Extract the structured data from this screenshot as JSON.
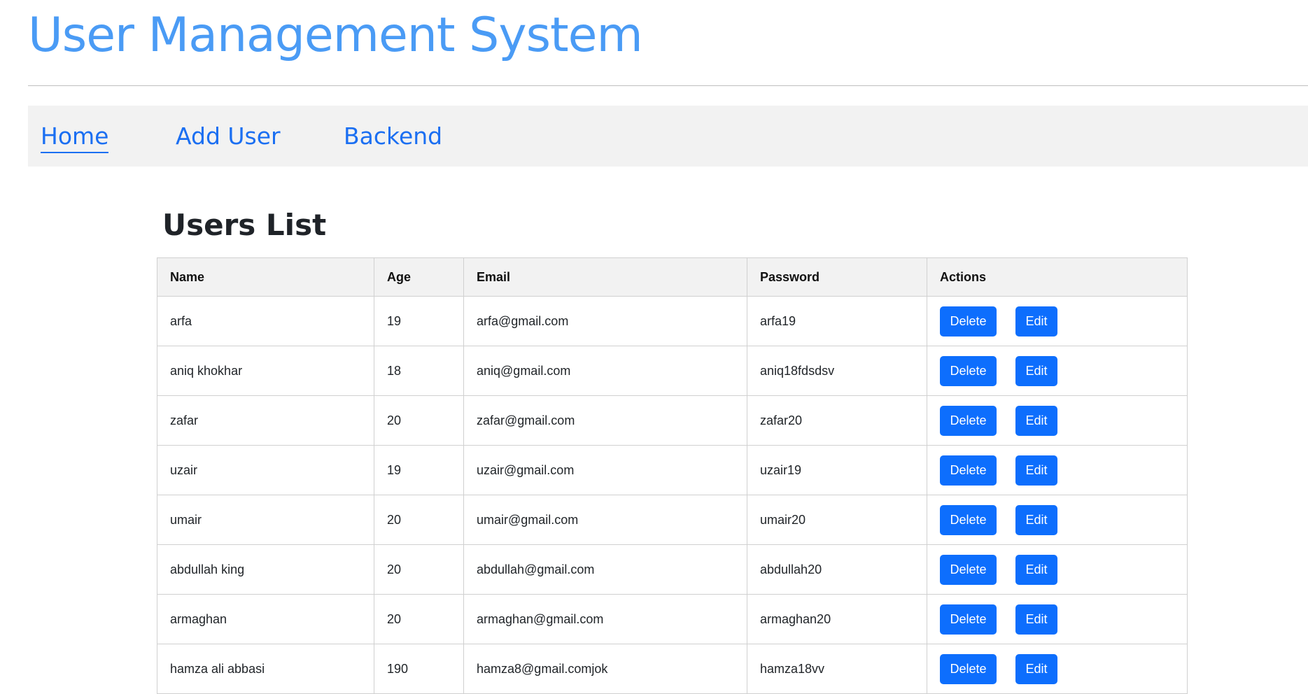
{
  "app": {
    "title": "User Management System"
  },
  "nav": {
    "items": [
      {
        "label": "Home",
        "active": true
      },
      {
        "label": "Add User",
        "active": false
      },
      {
        "label": "Backend",
        "active": false
      }
    ]
  },
  "main": {
    "heading": "Users List",
    "table": {
      "columns": [
        "Name",
        "Age",
        "Email",
        "Password",
        "Actions"
      ],
      "delete_label": "Delete",
      "edit_label": "Edit",
      "rows": [
        {
          "name": "arfa",
          "age": "19",
          "email": "arfa@gmail.com",
          "password": "arfa19"
        },
        {
          "name": "aniq khokhar",
          "age": "18",
          "email": "aniq@gmail.com",
          "password": "aniq18fdsdsv"
        },
        {
          "name": "zafar",
          "age": "20",
          "email": "zafar@gmail.com",
          "password": "zafar20"
        },
        {
          "name": "uzair",
          "age": "19",
          "email": "uzair@gmail.com",
          "password": "uzair19"
        },
        {
          "name": "umair",
          "age": "20",
          "email": "umair@gmail.com",
          "password": "umair20"
        },
        {
          "name": "abdullah king",
          "age": "20",
          "email": "abdullah@gmail.com",
          "password": "abdullah20"
        },
        {
          "name": "armaghan",
          "age": "20",
          "email": "armaghan@gmail.com",
          "password": "armaghan20"
        },
        {
          "name": "hamza ali abbasi",
          "age": "190",
          "email": "hamza8@gmail.comjok",
          "password": "hamza18vv"
        }
      ]
    }
  },
  "colors": {
    "title": "#4a9bf5",
    "nav_link": "#1b6ff2",
    "nav_background": "#f2f2f2",
    "button_primary": "#0d6efd",
    "table_header_background": "#f2f2f2"
  }
}
